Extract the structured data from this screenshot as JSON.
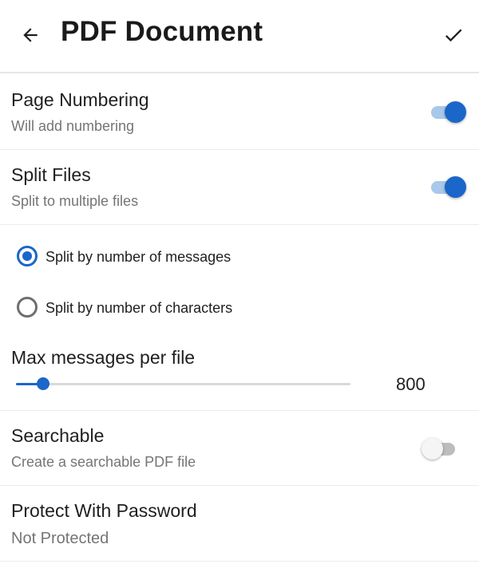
{
  "header": {
    "title": "PDF Document",
    "back_icon": "arrow-left-icon",
    "confirm_icon": "check-icon"
  },
  "settings": {
    "page_numbering": {
      "title": "Page Numbering",
      "subtitle": "Will add numbering",
      "enabled": true
    },
    "split_files": {
      "title": "Split Files",
      "subtitle": "Split to multiple files",
      "enabled": true
    },
    "split_options": [
      {
        "label": "Split by number of messages",
        "selected": true
      },
      {
        "label": "Split by number of characters",
        "selected": false
      }
    ],
    "max_messages": {
      "title": "Max messages per file",
      "value": "800",
      "level": 0.08
    },
    "searchable": {
      "title": "Searchable",
      "subtitle": "Create a searchable PDF file",
      "enabled": false
    },
    "password": {
      "title": "Protect With Password",
      "subtitle": "Not Protected"
    }
  },
  "colors": {
    "accent": "#1b66c9",
    "accent_track": "#a9c8ea",
    "text_primary": "#1f1f1f",
    "text_secondary": "#757575"
  }
}
